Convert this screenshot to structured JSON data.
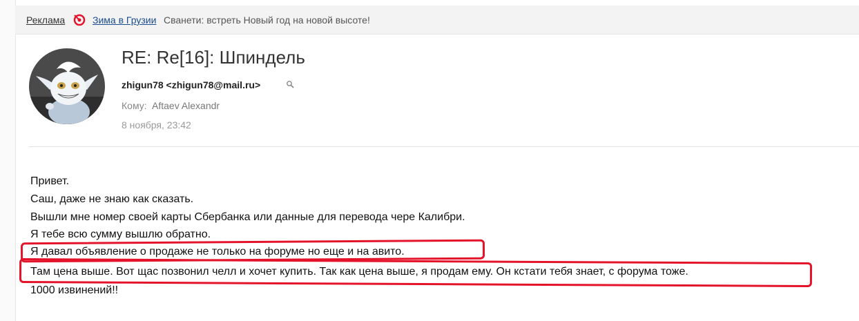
{
  "ad": {
    "label": "Реклама",
    "brand": "Зима в Грузии",
    "text": "Сванети: встреть Новый год на новой высоте!",
    "logo_color": "#e4132a"
  },
  "message": {
    "subject": "RE: Re[16]: Шпиндель",
    "sender": "zhigun78 <zhigun78@mail.ru>",
    "recipient_label": "Кому:",
    "recipient": "Aftaev Alexandr",
    "date": "8 ноября, 23:42",
    "avatar_icon": "cartoon-creature-avatar",
    "body": [
      "Привет.",
      "Саш, даже не знаю как сказать.",
      "Вышли мне номер своей карты Сбербанка или данные для перевода чере Калибри.",
      "Я тебе всю сумму вышлю обратно.",
      "Я давал объявление о продаже не только на форуме но еще и на авито.",
      "Там цена выше. Вот щас позвонил челл и хочет купить. Так как цена выше, я продам ему. Он кстати тебя знает, с форума тоже.",
      "1000 извинений!!"
    ]
  },
  "annotation_color": "#e4132a"
}
